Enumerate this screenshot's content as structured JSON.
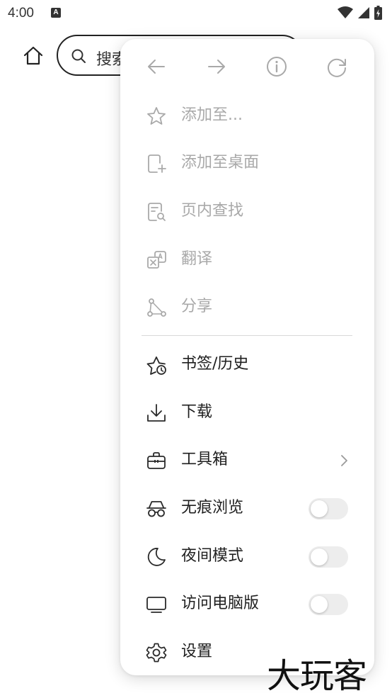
{
  "status_bar": {
    "time": "4:00",
    "notification_icon": "a-notification-icon"
  },
  "browser": {
    "search_placeholder": "搜索"
  },
  "menu": {
    "nav": {
      "back": "arrow-left-icon",
      "forward": "arrow-right-icon",
      "info": "info-icon",
      "refresh": "refresh-icon"
    },
    "items": [
      {
        "label": "添加至...",
        "icon": "star-icon",
        "enabled": false
      },
      {
        "label": "添加至桌面",
        "icon": "add-to-home-icon",
        "enabled": false
      },
      {
        "label": "页内查找",
        "icon": "find-in-page-icon",
        "enabled": false
      },
      {
        "label": "翻译",
        "icon": "translate-icon",
        "enabled": false
      },
      {
        "label": "分享",
        "icon": "share-icon",
        "enabled": false
      },
      {
        "label": "书签/历史",
        "icon": "bookmark-history-icon",
        "enabled": true
      },
      {
        "label": "下载",
        "icon": "download-icon",
        "enabled": true
      },
      {
        "label": "工具箱",
        "icon": "toolbox-icon",
        "enabled": true,
        "has_submenu": true
      },
      {
        "label": "无痕浏览",
        "icon": "incognito-icon",
        "enabled": true,
        "toggle": false
      },
      {
        "label": "夜间模式",
        "icon": "moon-icon",
        "enabled": true,
        "toggle": false
      },
      {
        "label": "访问电脑版",
        "icon": "desktop-icon",
        "enabled": true,
        "toggle": false
      },
      {
        "label": "设置",
        "icon": "gear-icon",
        "enabled": true
      }
    ]
  },
  "colors": {
    "text": "#1f1f1f",
    "disabled_text": "#a9a9a9",
    "toggle_off": "#ededed",
    "panel_bg": "#ffffff"
  },
  "watermark": "大玩客"
}
